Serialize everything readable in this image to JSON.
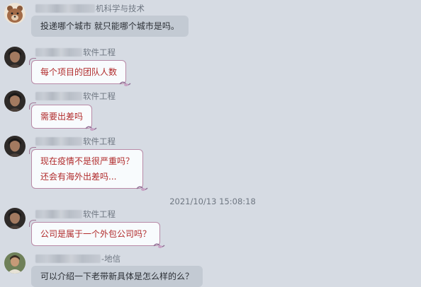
{
  "messages": [
    {
      "sender_suffix": "机科学与技术",
      "lines": [
        "投递哪个城市 就只能哪个城市是吗。"
      ]
    },
    {
      "sender_suffix": "软件工程",
      "lines": [
        "每个项目的团队人数"
      ]
    },
    {
      "sender_suffix": "软件工程",
      "lines": [
        "需要出差吗"
      ]
    },
    {
      "sender_suffix": "软件工程",
      "lines": [
        "现在疫情不是很严重吗？",
        "还会有海外出差吗..."
      ]
    },
    {
      "sender_suffix": "软件工程",
      "lines": [
        "公司是属于一个外包公司吗？"
      ]
    },
    {
      "sender_suffix": "-地信",
      "lines": [
        "可以介绍一下老带新具体是怎么样的么？"
      ]
    }
  ],
  "timestamp": "2021/10/13 15:08:18",
  "colors": {
    "background": "#d6dbe3",
    "plain_bubble": "#c3cad3",
    "deco_bubble_text": "#b02a2a",
    "deco_bubble_border": "#b88aa7"
  },
  "icons": {
    "avatar_1": "bear-avatar-icon",
    "avatar_2": "person-avatar-icon",
    "avatar_6": "person-avatar-icon",
    "bubble_decoration": "curl-ornament-icon"
  }
}
